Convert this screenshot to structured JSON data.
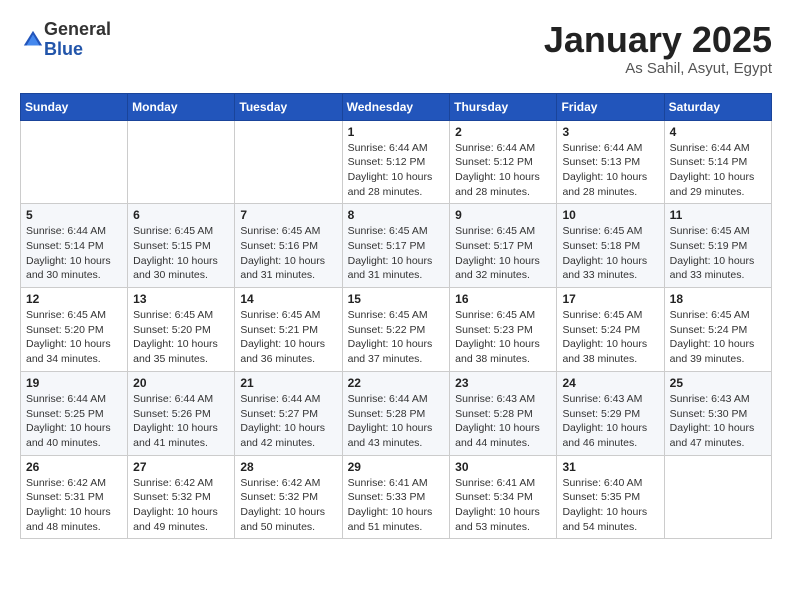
{
  "logo": {
    "general": "General",
    "blue": "Blue"
  },
  "header": {
    "title": "January 2025",
    "location": "As Sahil, Asyut, Egypt"
  },
  "weekdays": [
    "Sunday",
    "Monday",
    "Tuesday",
    "Wednesday",
    "Thursday",
    "Friday",
    "Saturday"
  ],
  "weeks": [
    [
      {
        "day": "",
        "info": ""
      },
      {
        "day": "",
        "info": ""
      },
      {
        "day": "",
        "info": ""
      },
      {
        "day": "1",
        "info": "Sunrise: 6:44 AM\nSunset: 5:12 PM\nDaylight: 10 hours\nand 28 minutes."
      },
      {
        "day": "2",
        "info": "Sunrise: 6:44 AM\nSunset: 5:12 PM\nDaylight: 10 hours\nand 28 minutes."
      },
      {
        "day": "3",
        "info": "Sunrise: 6:44 AM\nSunset: 5:13 PM\nDaylight: 10 hours\nand 28 minutes."
      },
      {
        "day": "4",
        "info": "Sunrise: 6:44 AM\nSunset: 5:14 PM\nDaylight: 10 hours\nand 29 minutes."
      }
    ],
    [
      {
        "day": "5",
        "info": "Sunrise: 6:44 AM\nSunset: 5:14 PM\nDaylight: 10 hours\nand 30 minutes."
      },
      {
        "day": "6",
        "info": "Sunrise: 6:45 AM\nSunset: 5:15 PM\nDaylight: 10 hours\nand 30 minutes."
      },
      {
        "day": "7",
        "info": "Sunrise: 6:45 AM\nSunset: 5:16 PM\nDaylight: 10 hours\nand 31 minutes."
      },
      {
        "day": "8",
        "info": "Sunrise: 6:45 AM\nSunset: 5:17 PM\nDaylight: 10 hours\nand 31 minutes."
      },
      {
        "day": "9",
        "info": "Sunrise: 6:45 AM\nSunset: 5:17 PM\nDaylight: 10 hours\nand 32 minutes."
      },
      {
        "day": "10",
        "info": "Sunrise: 6:45 AM\nSunset: 5:18 PM\nDaylight: 10 hours\nand 33 minutes."
      },
      {
        "day": "11",
        "info": "Sunrise: 6:45 AM\nSunset: 5:19 PM\nDaylight: 10 hours\nand 33 minutes."
      }
    ],
    [
      {
        "day": "12",
        "info": "Sunrise: 6:45 AM\nSunset: 5:20 PM\nDaylight: 10 hours\nand 34 minutes."
      },
      {
        "day": "13",
        "info": "Sunrise: 6:45 AM\nSunset: 5:20 PM\nDaylight: 10 hours\nand 35 minutes."
      },
      {
        "day": "14",
        "info": "Sunrise: 6:45 AM\nSunset: 5:21 PM\nDaylight: 10 hours\nand 36 minutes."
      },
      {
        "day": "15",
        "info": "Sunrise: 6:45 AM\nSunset: 5:22 PM\nDaylight: 10 hours\nand 37 minutes."
      },
      {
        "day": "16",
        "info": "Sunrise: 6:45 AM\nSunset: 5:23 PM\nDaylight: 10 hours\nand 38 minutes."
      },
      {
        "day": "17",
        "info": "Sunrise: 6:45 AM\nSunset: 5:24 PM\nDaylight: 10 hours\nand 38 minutes."
      },
      {
        "day": "18",
        "info": "Sunrise: 6:45 AM\nSunset: 5:24 PM\nDaylight: 10 hours\nand 39 minutes."
      }
    ],
    [
      {
        "day": "19",
        "info": "Sunrise: 6:44 AM\nSunset: 5:25 PM\nDaylight: 10 hours\nand 40 minutes."
      },
      {
        "day": "20",
        "info": "Sunrise: 6:44 AM\nSunset: 5:26 PM\nDaylight: 10 hours\nand 41 minutes."
      },
      {
        "day": "21",
        "info": "Sunrise: 6:44 AM\nSunset: 5:27 PM\nDaylight: 10 hours\nand 42 minutes."
      },
      {
        "day": "22",
        "info": "Sunrise: 6:44 AM\nSunset: 5:28 PM\nDaylight: 10 hours\nand 43 minutes."
      },
      {
        "day": "23",
        "info": "Sunrise: 6:43 AM\nSunset: 5:28 PM\nDaylight: 10 hours\nand 44 minutes."
      },
      {
        "day": "24",
        "info": "Sunrise: 6:43 AM\nSunset: 5:29 PM\nDaylight: 10 hours\nand 46 minutes."
      },
      {
        "day": "25",
        "info": "Sunrise: 6:43 AM\nSunset: 5:30 PM\nDaylight: 10 hours\nand 47 minutes."
      }
    ],
    [
      {
        "day": "26",
        "info": "Sunrise: 6:42 AM\nSunset: 5:31 PM\nDaylight: 10 hours\nand 48 minutes."
      },
      {
        "day": "27",
        "info": "Sunrise: 6:42 AM\nSunset: 5:32 PM\nDaylight: 10 hours\nand 49 minutes."
      },
      {
        "day": "28",
        "info": "Sunrise: 6:42 AM\nSunset: 5:32 PM\nDaylight: 10 hours\nand 50 minutes."
      },
      {
        "day": "29",
        "info": "Sunrise: 6:41 AM\nSunset: 5:33 PM\nDaylight: 10 hours\nand 51 minutes."
      },
      {
        "day": "30",
        "info": "Sunrise: 6:41 AM\nSunset: 5:34 PM\nDaylight: 10 hours\nand 53 minutes."
      },
      {
        "day": "31",
        "info": "Sunrise: 6:40 AM\nSunset: 5:35 PM\nDaylight: 10 hours\nand 54 minutes."
      },
      {
        "day": "",
        "info": ""
      }
    ]
  ]
}
